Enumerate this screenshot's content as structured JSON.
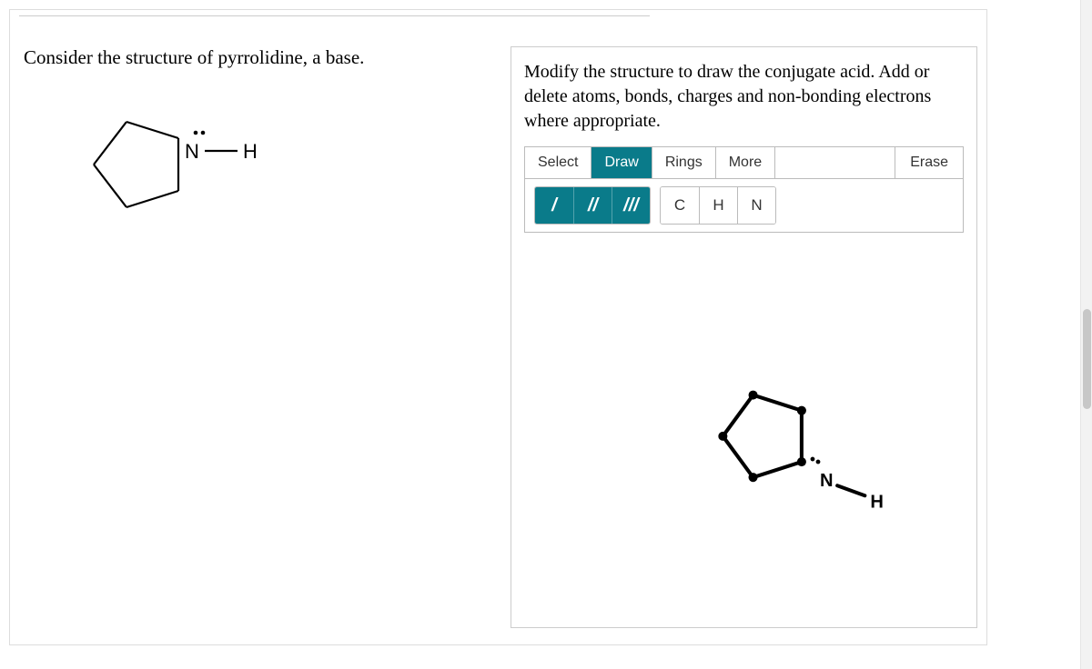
{
  "left": {
    "prompt": "Consider the structure of pyrrolidine, a base.",
    "atom_n": "N",
    "atom_h": "H"
  },
  "right": {
    "instruction": "Modify the structure to draw the conjugate acid. Add or delete atoms, bonds, charges and non-bonding electrons where appropriate.",
    "tabs": {
      "select": "Select",
      "draw": "Draw",
      "rings": "Rings",
      "more": "More",
      "erase": "Erase"
    },
    "bond_tools": {
      "single": "/",
      "double": "//",
      "triple": "///"
    },
    "atom_tools": {
      "c": "C",
      "h": "H",
      "n": "N"
    },
    "canvas_mol": {
      "n": "N",
      "h": "H"
    }
  }
}
